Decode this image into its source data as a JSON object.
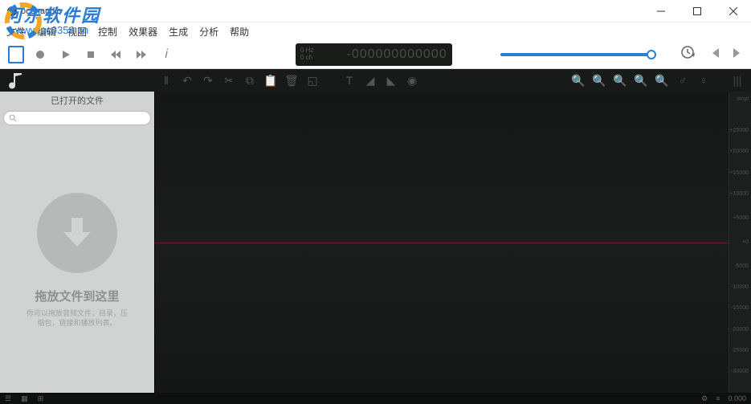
{
  "app": {
    "title": "ocenaudio"
  },
  "watermark": {
    "text": "河东软件园",
    "url": "www.pc0359.cn"
  },
  "menu": {
    "file": "文件",
    "edit": "编辑",
    "view": "视图",
    "control": "控制",
    "effects": "效果器",
    "generate": "生成",
    "analysis": "分析",
    "help": "帮助"
  },
  "display": {
    "hz": "0 Hz",
    "ch": "0 ch",
    "time": "-000000000000"
  },
  "sidebar": {
    "header": "已打开的文件",
    "drop_title": "拖放文件到这里",
    "drop_sub1": "你可以拖放音频文件，目录，压",
    "drop_sub2": "缩包，链接和播放列表。"
  },
  "scale": {
    "top": "smpl",
    "ticks": [
      "+25000",
      "+20000",
      "+15000",
      "+10000",
      "+5000",
      "+0",
      "-5000",
      "-10000",
      "-15000",
      "-20000",
      "-25000",
      "-30000"
    ]
  },
  "status": {
    "time": "0.000"
  }
}
